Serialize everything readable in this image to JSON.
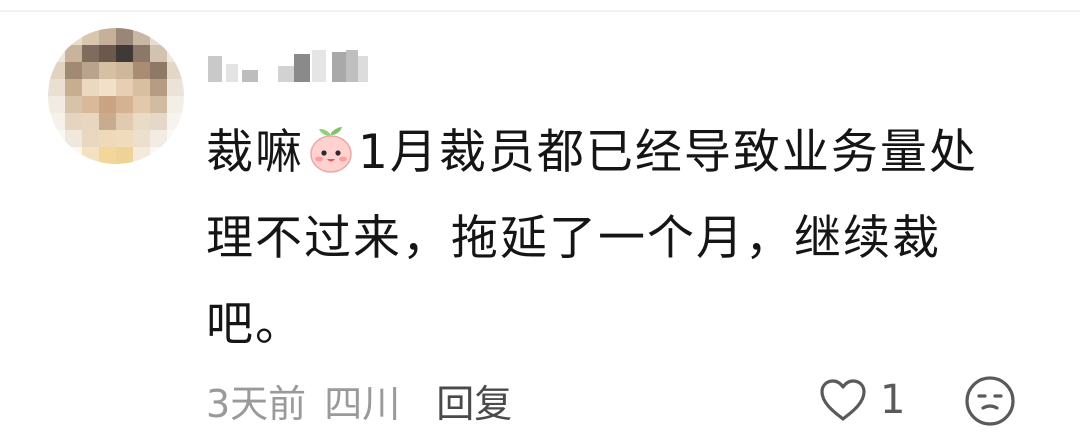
{
  "comment": {
    "line1_before_emoji": "裁嘛",
    "line1_after_emoji": "1月裁员都已经导致业务量处",
    "line2": "理不过来，拖延了一个月，继续裁",
    "line3": "吧。"
  },
  "meta": {
    "time": "3天前",
    "location": "四川",
    "reply_label": "回复"
  },
  "actions": {
    "like_count": "1",
    "like_icon": "heart-outline-icon",
    "react_icon": "neutral-face-icon"
  },
  "colors": {
    "text": "#151515",
    "meta": "#9a9a9a",
    "reply": "#4a4a4a",
    "emoji_peach": "#ffd1cf"
  }
}
